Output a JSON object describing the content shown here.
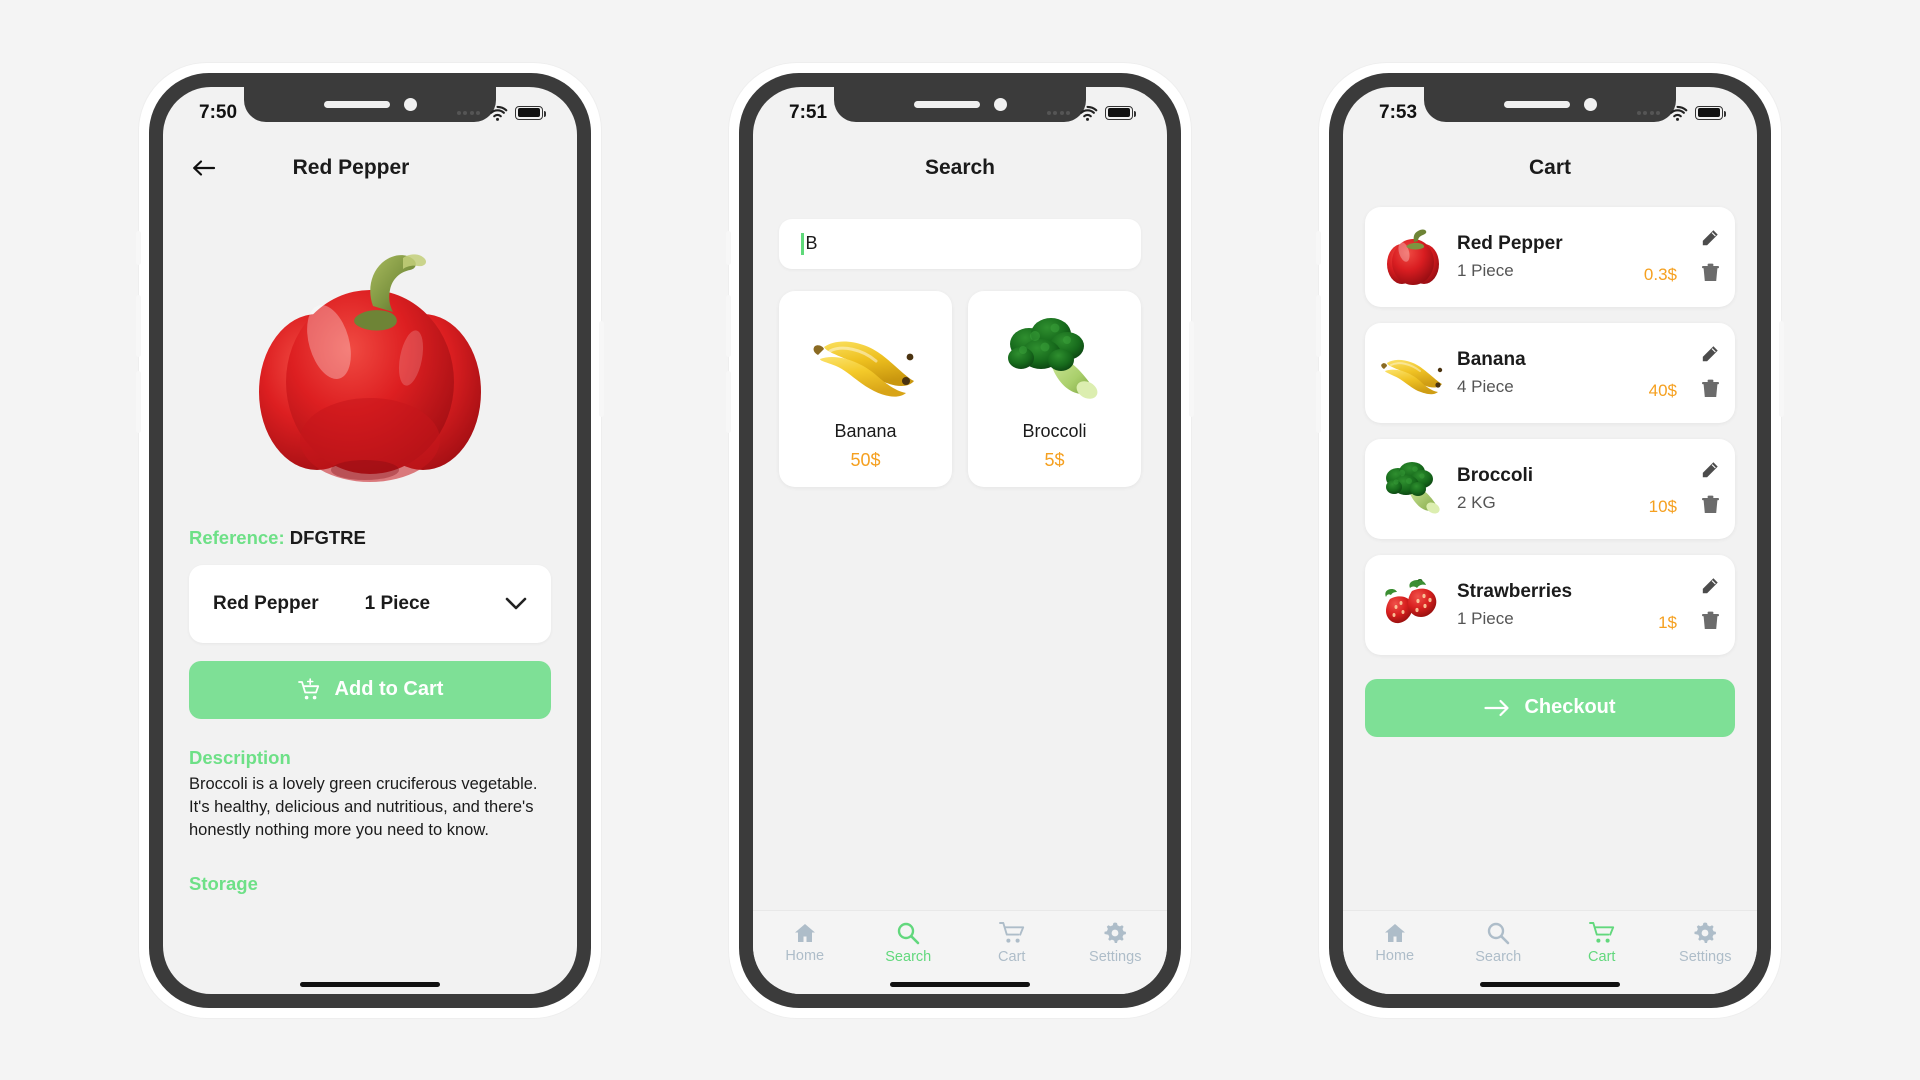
{
  "theme": {
    "accent_green": "#7ee096",
    "label_green": "#6ee087",
    "price_orange": "#f5a020",
    "tab_inactive": "#aebdc9",
    "tab_active": "#62d87d",
    "screen_bg": "#f2f2f2"
  },
  "phones": [
    {
      "screen_name": "product-detail",
      "status_bar": {
        "time": "7:50",
        "wifi": "wifi-icon",
        "battery": "battery-icon",
        "signal": "signal-dots-icon"
      },
      "header": {
        "back": "back-arrow-icon",
        "title": "Red Pepper"
      },
      "hero_image": "red-pepper-image",
      "reference": {
        "label": "Reference:",
        "value": "DFGTRE"
      },
      "selector": {
        "product": "Red Pepper",
        "unit": "1 Piece",
        "chevron": "chevron-down-icon"
      },
      "add_to_cart": {
        "label": "Add to Cart",
        "icon": "add-to-cart-icon"
      },
      "description": {
        "heading": "Description",
        "text": "Broccoli is a lovely green cruciferous vegetable. It's healthy, delicious and nutritious, and there's honestly nothing more you need to know."
      },
      "storage": {
        "heading": "Storage"
      }
    },
    {
      "screen_name": "search",
      "status_bar": {
        "time": "7:51",
        "wifi": "wifi-icon",
        "battery": "battery-icon",
        "signal": "signal-dots-icon"
      },
      "header": {
        "title": "Search"
      },
      "search": {
        "value": "B",
        "placeholder": ""
      },
      "results": [
        {
          "name": "Banana",
          "price": "50$",
          "image": "banana-image"
        },
        {
          "name": "Broccoli",
          "price": "5$",
          "image": "broccoli-image"
        }
      ],
      "tabs": [
        {
          "label": "Home",
          "icon": "home-icon",
          "active": false
        },
        {
          "label": "Search",
          "icon": "search-icon",
          "active": true
        },
        {
          "label": "Cart",
          "icon": "cart-icon",
          "active": false
        },
        {
          "label": "Settings",
          "icon": "gear-icon",
          "active": false
        }
      ]
    },
    {
      "screen_name": "cart",
      "status_bar": {
        "time": "7:53",
        "wifi": "wifi-icon",
        "battery": "battery-icon",
        "signal": "signal-dots-icon"
      },
      "header": {
        "title": "Cart"
      },
      "items": [
        {
          "name": "Red Pepper",
          "qty": "1 Piece",
          "price": "0.3$",
          "image": "red-pepper-image"
        },
        {
          "name": "Banana",
          "qty": "4 Piece",
          "price": "40$",
          "image": "banana-image"
        },
        {
          "name": "Broccoli",
          "qty": "2 KG",
          "price": "10$",
          "image": "broccoli-image"
        },
        {
          "name": "Strawberries",
          "qty": "1 Piece",
          "price": "1$",
          "image": "strawberries-image"
        }
      ],
      "checkout": {
        "label": "Checkout",
        "icon": "arrow-right-icon"
      },
      "tabs": [
        {
          "label": "Home",
          "icon": "home-icon",
          "active": false
        },
        {
          "label": "Search",
          "icon": "search-icon",
          "active": false
        },
        {
          "label": "Cart",
          "icon": "cart-icon",
          "active": true
        },
        {
          "label": "Settings",
          "icon": "gear-icon",
          "active": false
        }
      ]
    }
  ]
}
